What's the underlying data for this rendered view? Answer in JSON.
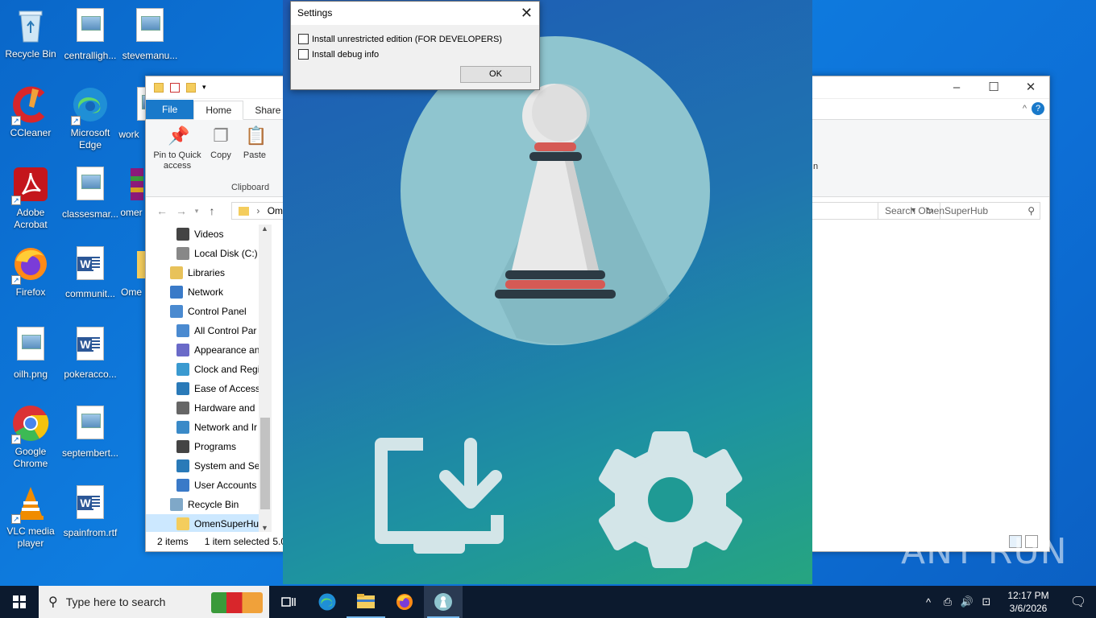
{
  "desktop": {
    "icons": [
      {
        "label": "Recycle Bin"
      },
      {
        "label": "centralligh..."
      },
      {
        "label": "stevemanu..."
      },
      {
        "label": "CCleaner"
      },
      {
        "label": "Microsoft Edge"
      },
      {
        "label": "work"
      },
      {
        "label": "Adobe Acrobat"
      },
      {
        "label": "classesmar..."
      },
      {
        "label": "omer"
      },
      {
        "label": "Firefox"
      },
      {
        "label": "communit..."
      },
      {
        "label": "Ome"
      },
      {
        "label": "oilh.png"
      },
      {
        "label": "pokeracco..."
      },
      {
        "label": "Google Chrome"
      },
      {
        "label": "septembert..."
      },
      {
        "label": "VLC media player"
      },
      {
        "label": "spainfrom.rtf"
      }
    ]
  },
  "explorer": {
    "tabs": {
      "file": "File",
      "home": "Home",
      "share": "Share"
    },
    "ribbon": {
      "pin": "Pin to Quick access",
      "copy": "Copy",
      "paste": "Paste",
      "group": "Clipboard",
      "cut_partial": "n"
    },
    "address": "Ome",
    "search_placeholder": "Search OmenSuperHub",
    "nav": [
      "Videos",
      "Local Disk (C:)",
      "Libraries",
      "Network",
      "Control Panel",
      "All Control Par",
      "Appearance an",
      "Clock and Regi",
      "Ease of Access",
      "Hardware and",
      "Network and Ir",
      "Programs",
      "System and Se",
      "User Accounts",
      "Recycle Bin",
      "OmenSuperHub"
    ],
    "status": {
      "items": "2 items",
      "selected": "1 item selected",
      "size": "5.0"
    }
  },
  "settings": {
    "title": "Settings",
    "option1": "Install unrestricted edition (FOR DEVELOPERS)",
    "option2": "Install debug info",
    "ok": "OK"
  },
  "watermark": "ANY RUN",
  "taskbar": {
    "search_placeholder": "Type here to search",
    "time": "12:17 PM",
    "date": "3/6/2026"
  },
  "colors": {
    "accent": "#1979ca",
    "taskbar": "#0c1a2e",
    "selection": "#cce8ff"
  }
}
